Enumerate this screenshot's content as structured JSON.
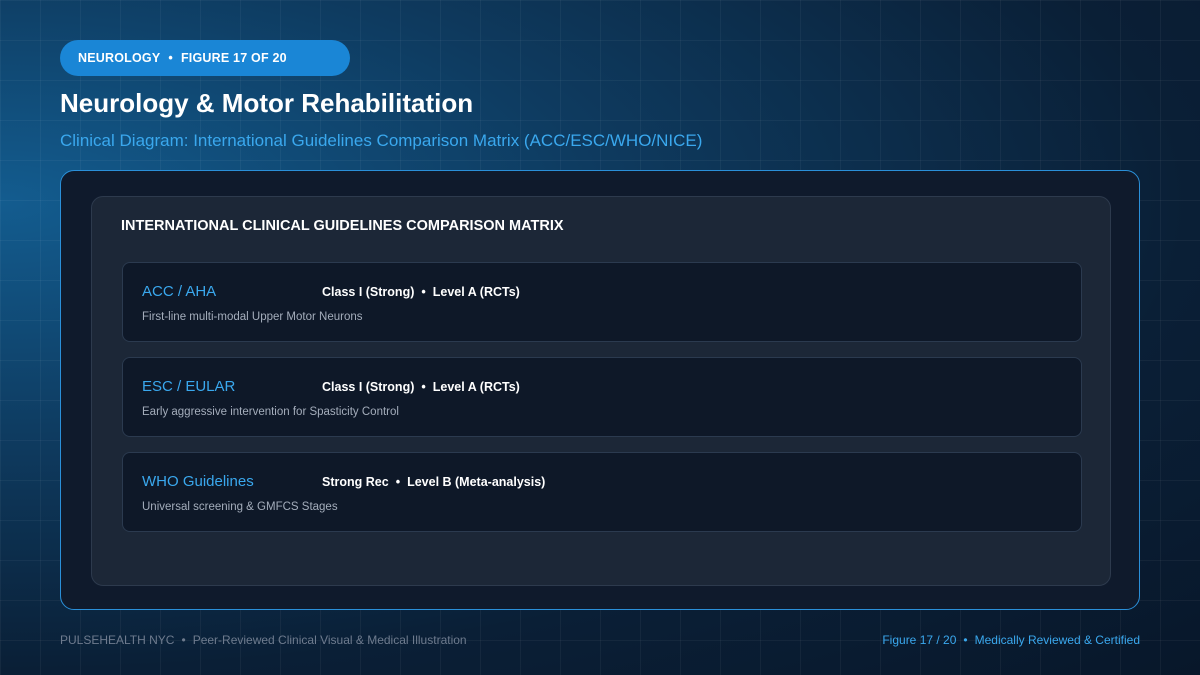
{
  "badge": {
    "section": "NEUROLOGY",
    "separator": "•",
    "figure": "FIGURE 17 OF 20"
  },
  "header": {
    "title": "Neurology & Motor Rehabilitation",
    "subtitle": "Clinical Diagram: International Guidelines Comparison Matrix (ACC/ESC/WHO/NICE)"
  },
  "matrix": {
    "title": "INTERNATIONAL CLINICAL GUIDELINES COMPARISON MATRIX",
    "rows": [
      {
        "org": "ACC / AHA",
        "strength": "Class I (Strong)",
        "separator": "•",
        "level": "Level A (RCTs)",
        "description": "First-line multi-modal Upper Motor Neurons"
      },
      {
        "org": "ESC / EULAR",
        "strength": "Class I (Strong)",
        "separator": "•",
        "level": "Level A (RCTs)",
        "description": "Early aggressive intervention for Spasticity Control"
      },
      {
        "org": "WHO Guidelines",
        "strength": "Strong Rec",
        "separator": "•",
        "level": "Level B (Meta-analysis)",
        "description": "Universal screening & GMFCS Stages"
      }
    ]
  },
  "footer": {
    "brand": "PULSEHEALTH NYC",
    "separator": "•",
    "tagline": "Peer-Reviewed Clinical Visual & Medical Illustration",
    "figure": "Figure 17 / 20",
    "certification": "Medically Reviewed & Certified"
  },
  "colors": {
    "accent": "#3aa8ee",
    "badge": "#1a86d6",
    "panel_border": "#2a8fd8",
    "background": "#0a1f36"
  }
}
